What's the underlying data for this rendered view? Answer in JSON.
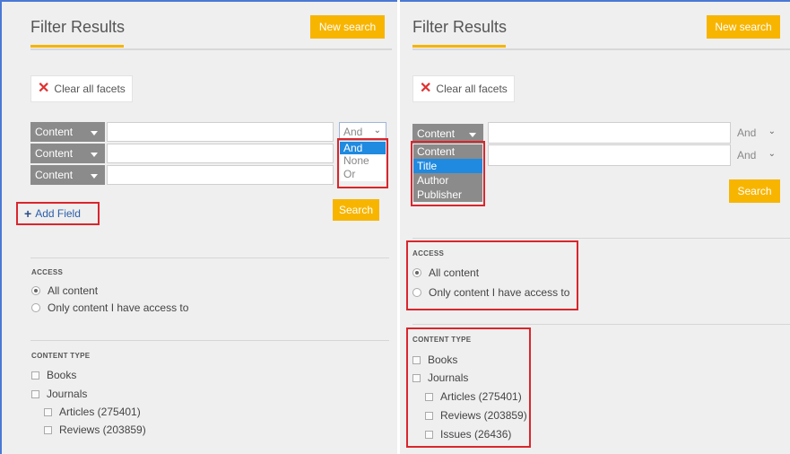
{
  "left": {
    "title": "Filter Results",
    "new_search": "New search",
    "clear_all": "Clear all facets",
    "rows": [
      {
        "field": "Content",
        "op": "And"
      },
      {
        "field": "Content"
      },
      {
        "field": "Content"
      }
    ],
    "op_options": [
      "And",
      "None",
      "Or"
    ],
    "add_field": "Add Field",
    "search": "Search",
    "access_title": "ACCESS",
    "access_options": [
      "All content",
      "Only content I have access to"
    ],
    "content_type_title": "CONTENT TYPE",
    "content_types": [
      "Books",
      "Journals",
      "Articles (275401)",
      "Reviews (203859)"
    ]
  },
  "right": {
    "title": "Filter Results",
    "new_search": "New search",
    "clear_all": "Clear all facets",
    "rows": [
      {
        "field": "Content",
        "op": "And"
      },
      {
        "op": "And"
      }
    ],
    "field_options": [
      "Content",
      "Title",
      "Author",
      "Publisher"
    ],
    "search": "Search",
    "access_title": "ACCESS",
    "access_options": [
      "All content",
      "Only content I have access to"
    ],
    "content_type_title": "CONTENT TYPE",
    "content_types": [
      "Books",
      "Journals",
      "Articles (275401)",
      "Reviews (203859)",
      "Issues (26436)"
    ]
  },
  "colors": {
    "accent": "#f7b500",
    "highlight_box": "#d9262c",
    "selected_option": "#1f8ae0"
  }
}
